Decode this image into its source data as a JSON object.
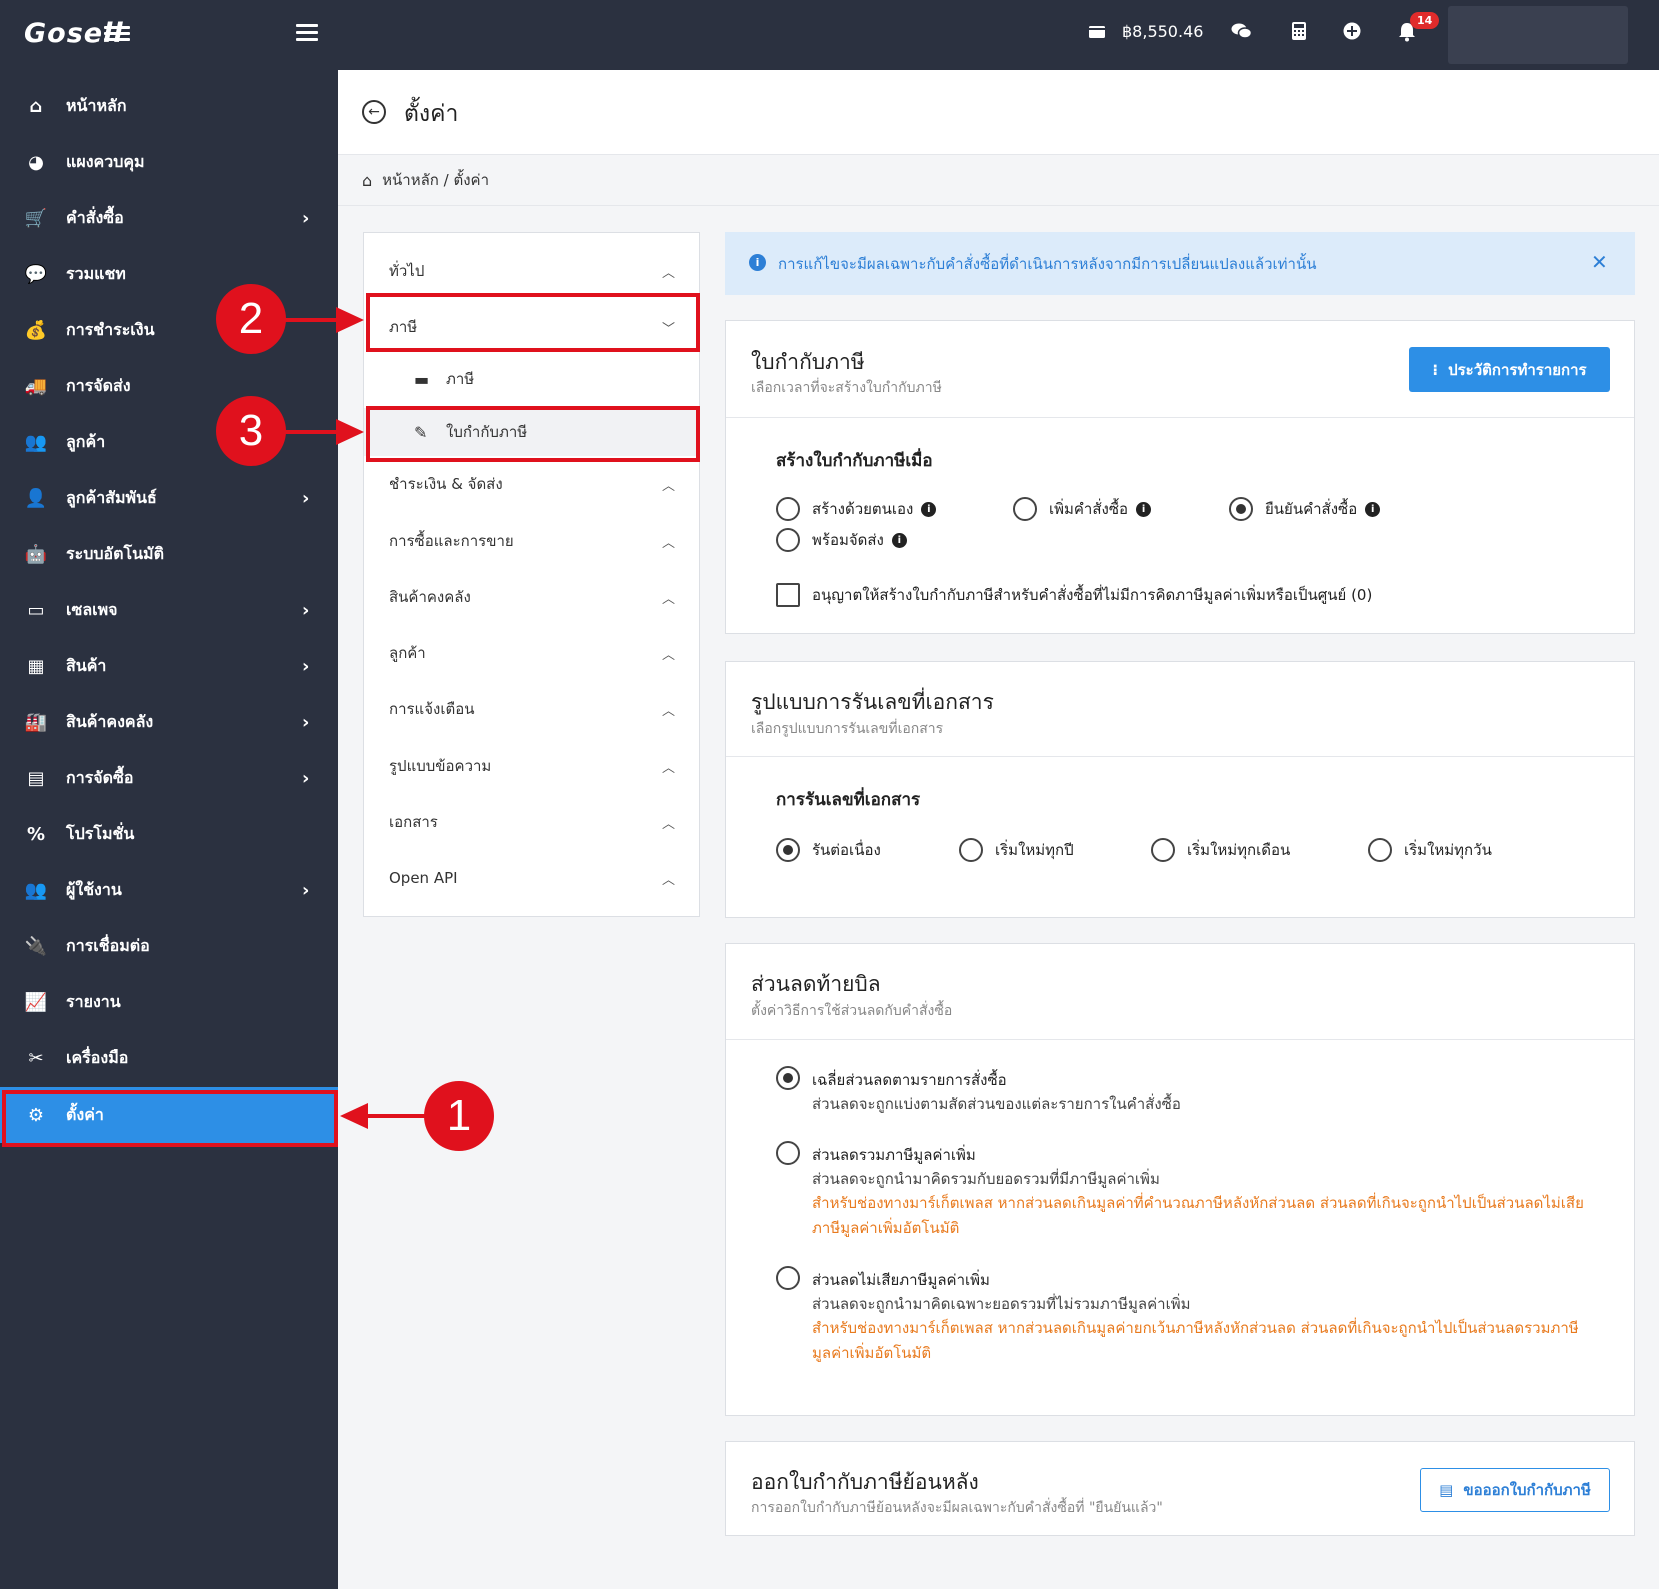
{
  "topbar": {
    "logo": "Gosell",
    "balance": "฿8,550.46",
    "notification_count": "14"
  },
  "sidebar": {
    "items": [
      {
        "label": "หน้าหลัก",
        "icon": "home-icon",
        "has_chevron": false
      },
      {
        "label": "แผงควบคุม",
        "icon": "dashboard-icon",
        "has_chevron": false
      },
      {
        "label": "คำสั่งซื้อ",
        "icon": "cart-icon",
        "has_chevron": true
      },
      {
        "label": "รวมแชท",
        "icon": "chat-icon",
        "has_chevron": false
      },
      {
        "label": "การชำระเงิน",
        "icon": "money-bag-icon",
        "has_chevron": false
      },
      {
        "label": "การจัดส่ง",
        "icon": "truck-icon",
        "has_chevron": false
      },
      {
        "label": "ลูกค้า",
        "icon": "users-icon",
        "has_chevron": false
      },
      {
        "label": "ลูกค้าสัมพันธ์",
        "icon": "support-agent-icon",
        "has_chevron": true
      },
      {
        "label": "ระบบอัตโนมัติ",
        "icon": "robot-icon",
        "has_chevron": false
      },
      {
        "label": "เซลเพจ",
        "icon": "window-icon",
        "has_chevron": true
      },
      {
        "label": "สินค้า",
        "icon": "boxes-icon",
        "has_chevron": true
      },
      {
        "label": "สินค้าคงคลัง",
        "icon": "warehouse-icon",
        "has_chevron": true
      },
      {
        "label": "การจัดซื้อ",
        "icon": "pallet-icon",
        "has_chevron": true
      },
      {
        "label": "โปรโมชั่น",
        "icon": "percent-icon",
        "has_chevron": false
      },
      {
        "label": "ผู้ใช้งาน",
        "icon": "user-group-icon",
        "has_chevron": true
      },
      {
        "label": "การเชื่อมต่อ",
        "icon": "plug-icon",
        "has_chevron": false
      },
      {
        "label": "รายงาน",
        "icon": "chart-icon",
        "has_chevron": false
      },
      {
        "label": "เครื่องมือ",
        "icon": "tools-icon",
        "has_chevron": false
      },
      {
        "label": "ตั้งค่า",
        "icon": "gear-icon",
        "has_chevron": false,
        "active": true
      }
    ]
  },
  "header": {
    "title": "ตั้งค่า",
    "breadcrumb": "หน้าหลัก / ตั้งค่า"
  },
  "settings_menu": {
    "general": "ทั่วไป",
    "tax": "ภาษี",
    "tax_sub": "ภาษี",
    "tax_invoice_sub": "ใบกำกับภาษี",
    "payment_shipping": "ชำระเงิน & จัดส่ง",
    "buying_selling": "การซื้อและการขาย",
    "inventory": "สินค้าคงคลัง",
    "customers": "ลูกค้า",
    "notifications": "การแจ้งเตือน",
    "message_templates": "รูปแบบข้อความ",
    "documents": "เอกสาร",
    "open_api": "Open API"
  },
  "annotations": {
    "one": "1",
    "two": "2",
    "three": "3",
    "color": "#e0111d"
  },
  "alert": {
    "text": "การแก้ไขจะมีผลเฉพาะกับคำสั่งซื้อที่ดำเนินการหลังจากมีการเปลี่ยนแปลงแล้วเท่านั้น"
  },
  "tax_invoice_card": {
    "title": "ใบกำกับภาษี",
    "subtitle": "เลือกเวลาที่จะสร้างใบกำกับภาษี",
    "history_button": "ประวัติการทำรายการ",
    "section_label": "สร้างใบกำกับภาษีเมื่อ",
    "options": [
      "สร้างด้วยตนเอง",
      "เพิ่มคำสั่งซื้อ",
      "ยืนยันคำสั่งซื้อ",
      "พร้อมจัดส่ง"
    ],
    "selected_option": "ยืนยันคำสั่งซื้อ",
    "checkbox_label": "อนุญาตให้สร้างใบกำกับภาษีสำหรับคำสั่งซื้อที่ไม่มีการคิดภาษีมูลค่าเพิ่มหรือเป็นศูนย์ (0)"
  },
  "numbering_card": {
    "title": "รูปแบบการรันเลขที่เอกสาร",
    "subtitle": "เลือกรูปแบบการรันเลขที่เอกสาร",
    "section_label": "การรันเลขที่เอกสาร",
    "options": [
      "รันต่อเนื่อง",
      "เริ่มใหม่ทุกปี",
      "เริ่มใหม่ทุกเดือน",
      "เริ่มใหม่ทุกวัน"
    ],
    "selected_option": "รันต่อเนื่อง"
  },
  "discount_card": {
    "title": "ส่วนลดท้ายบิล",
    "subtitle": "ตั้งค่าวิธีการใช้ส่วนลดกับคำสั่งซื้อ",
    "options": [
      {
        "title": "เฉลี่ยส่วนลดตามรายการสั่งซื้อ",
        "desc": "ส่วนลดจะถูกแบ่งตามสัดส่วนของแต่ละรายการในคำสั่งซื้อ",
        "warning": "",
        "selected": true
      },
      {
        "title": "ส่วนลดรวมภาษีมูลค่าเพิ่ม",
        "desc": "ส่วนลดจะถูกนำมาคิดรวมกับยอดรวมที่มีภาษีมูลค่าเพิ่ม",
        "warning": "สำหรับช่องทางมาร์เก็ตเพลส หากส่วนลดเกินมูลค่าที่คำนวณภาษีหลังหักส่วนลด ส่วนลดที่เกินจะถูกนำไปเป็นส่วนลดไม่เสียภาษีมูลค่าเพิ่มอัตโนมัติ",
        "selected": false
      },
      {
        "title": "ส่วนลดไม่เสียภาษีมูลค่าเพิ่ม",
        "desc": "ส่วนลดจะถูกนำมาคิดเฉพาะยอดรวมที่ไม่รวมภาษีมูลค่าเพิ่ม",
        "warning": "สำหรับช่องทางมาร์เก็ตเพลส หากส่วนลดเกินมูลค่ายกเว้นภาษีหลังหักส่วนลด ส่วนลดที่เกินจะถูกนำไปเป็นส่วนลดรวมภาษีมูลค่าเพิ่มอัตโนมัติ",
        "selected": false
      }
    ],
    "warning_color": "#e87a1e"
  },
  "retro_card": {
    "title": "ออกใบกำกับภาษีย้อนหลัง",
    "subtitle": "การออกใบกำกับภาษีย้อนหลังจะมีผลเฉพาะกับคำสั่งซื้อที่ \"ยืนยันแล้ว\"",
    "button": "ขอออกใบกำกับภาษี"
  },
  "colors": {
    "sidebar_bg": "#2b3140",
    "accent": "#2d8fe6",
    "annotation": "#e0111d"
  }
}
